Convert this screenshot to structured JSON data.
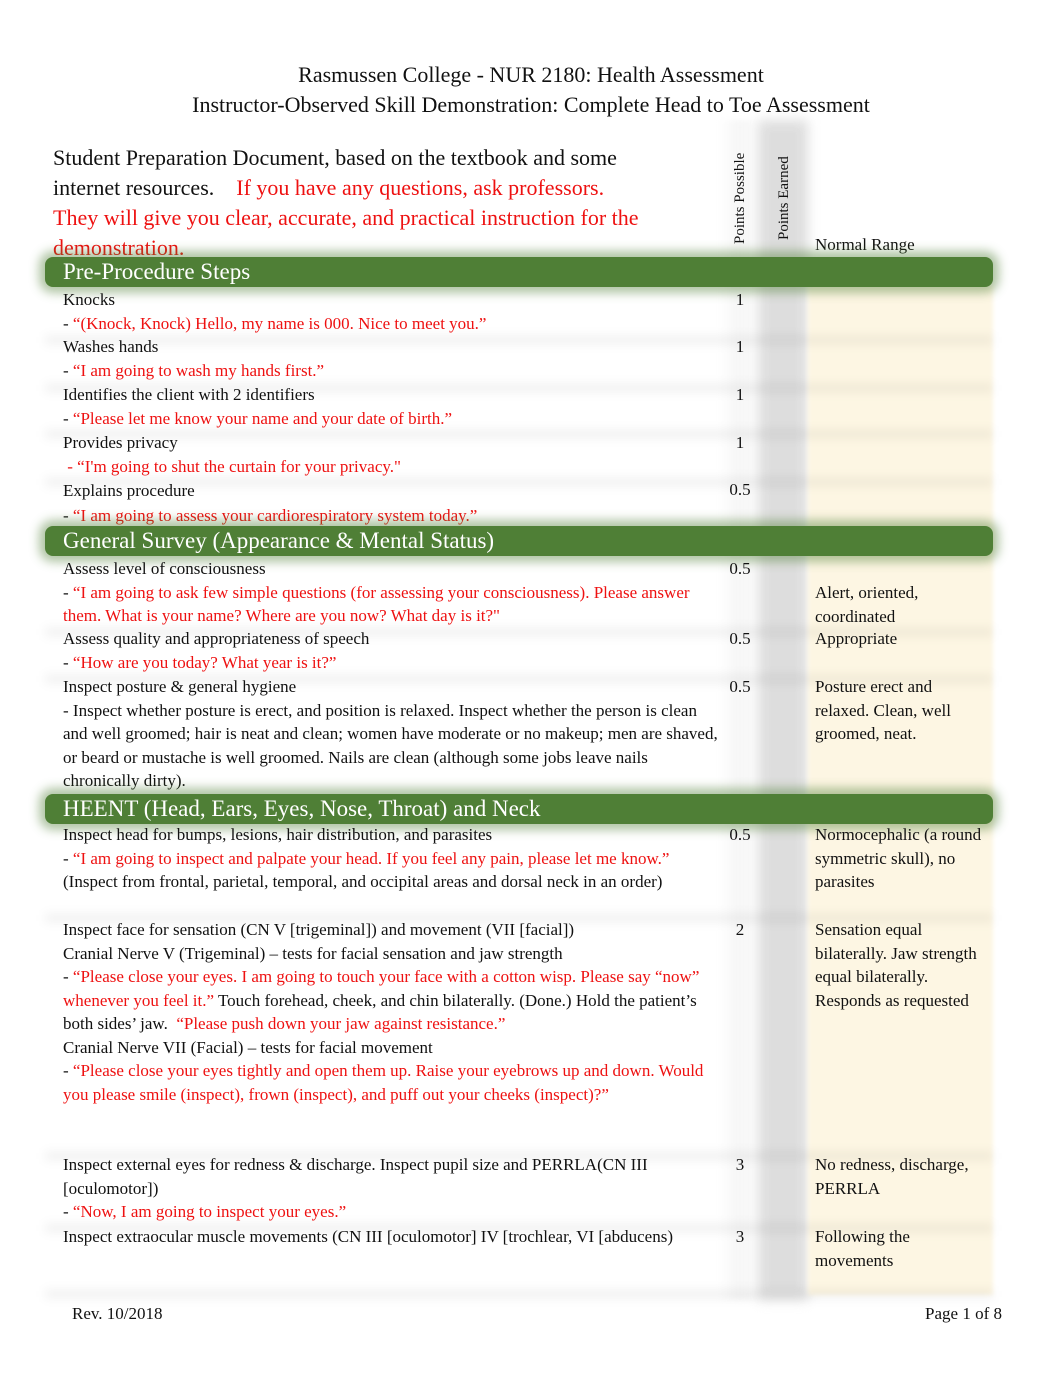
{
  "header": {
    "title_line1": "Rasmussen College - NUR 2180: Health Assessment",
    "title_line2": "Instructor-Observed Skill Demonstration: Complete Head to Toe Assessment"
  },
  "intro": {
    "black_text": "Student Preparation Document, based on the textbook and some internet resources.",
    "red_text": "If you have any questions, ask professors. They will give you clear, accurate, and practical instruction for the demonstration."
  },
  "columns": {
    "points_possible": "Points Possible",
    "points_earned": "Points Earned",
    "normal_range": "Normal Range"
  },
  "colors": {
    "section_green": "#4f7f36",
    "script_red": "#ee1111",
    "points_earned_gray": "#dcdcdc",
    "normal_range_cream": "#fdf6e3"
  },
  "sections": [
    {
      "title": "Pre-Procedure Steps",
      "items": [
        {
          "label": "Knocks",
          "dash": "- ",
          "script": "“(Knock, Knock) Hello, my name is 000. Nice to meet you.”",
          "points": "1",
          "normal": ""
        },
        {
          "label": "Washes hands",
          "dash": "- ",
          "script": "“I am going to wash my hands first.”",
          "points": "1",
          "normal": ""
        },
        {
          "label": "Identifies the client with 2 identifiers",
          "dash": "- ",
          "script": "“Please let me know your name and your date of birth.”",
          "points": "1",
          "normal": ""
        },
        {
          "label": "Provides privacy",
          "dash": " - ",
          "script": "“I'm going to shut the curtain for your privacy.\"",
          "points": "1",
          "normal": ""
        },
        {
          "label": "Explains procedure",
          "dash": "- ",
          "script": "“I am going to assess your cardiorespiratory system today.”",
          "points": "0.5",
          "normal": ""
        }
      ]
    },
    {
      "title": "General Survey (Appearance & Mental Status)",
      "items": [
        {
          "label": "Assess level of consciousness",
          "dash": "- ",
          "script": "“I am going to ask few simple questions (for assessing your consciousness). Please answer them.  What is your name? Where are you now? What day is it?\"",
          "points": "0.5",
          "normal": "Alert, oriented, coordinated"
        },
        {
          "label": "Assess quality and appropriateness of speech",
          "dash": "- ",
          "script": "“How are you today? What year is it?”",
          "points": "0.5",
          "normal": "Appropriate"
        },
        {
          "label": "Inspect posture & general hygiene",
          "note": "- Inspect whether posture is erect, and position is relaxed. Inspect whether the person is clean and well groomed; hair is neat and clean; women have moderate or no makeup; men are shaved, or beard or mustache is well groomed. Nails are clean (although some jobs leave nails chronically dirty).",
          "points": "0.5",
          "normal": "Posture erect and relaxed. Clean, well groomed, neat."
        }
      ]
    },
    {
      "title": "HEENT (Head, Ears, Eyes, Nose, Throat) and Neck",
      "items": [
        {
          "label": "Inspect head for bumps, lesions, hair distribution, and parasites",
          "dash": "- ",
          "script": "“I am going to inspect and palpate your head. If you feel any pain, please let me know.”",
          "note": " (Inspect from frontal, parietal, temporal, and occipital areas and dorsal neck in an order)",
          "points": "0.5",
          "normal": "Normocephalic (a round symmetric skull), no parasites"
        },
        {
          "label": "Inspect face for sensation (CN V [trigeminal]) and movement (VII [facial])",
          "sub1_label": "Cranial Nerve V (Trigeminal) – tests for facial sensation and jaw strength",
          "sub1_dash": "- ",
          "sub1_script": "“Please close your eyes. I am going to touch your face with a cotton wisp. Please say “now” whenever you feel it.”",
          "sub1_note": " Touch forehead, cheek, and chin bilaterally. (Done.) Hold the patient’s both sides’ jaw.  ",
          "sub1_script2": "“Please push down your jaw against resistance.”",
          "sub2_label": "Cranial Nerve VII (Facial) – tests for facial movement",
          "sub2_dash": "- ",
          "sub2_script": "“Please close your eyes tightly and open them up. Raise your eyebrows up and down. Would you please smile (inspect), frown (inspect), and puff out your cheeks (inspect)?”",
          "points": "2",
          "normal": "Sensation equal bilaterally. Jaw strength equal bilaterally. Responds as requested"
        },
        {
          "label": "Inspect external eyes for redness & discharge. Inspect pupil size and PERRLA(CN III [oculomotor])",
          "dash": "- ",
          "script": "“Now, I am going to inspect your eyes.”",
          "points": "3",
          "normal": "No redness, discharge, PERRLA"
        },
        {
          "label": "Inspect extraocular muscle movements  (CN III [oculomotor] IV [trochlear, VI [abducens)",
          "points": "3",
          "normal": "Following the movements"
        }
      ]
    }
  ],
  "footer": {
    "revision": "Rev. 10/2018",
    "page": "Page 1 of 8"
  }
}
